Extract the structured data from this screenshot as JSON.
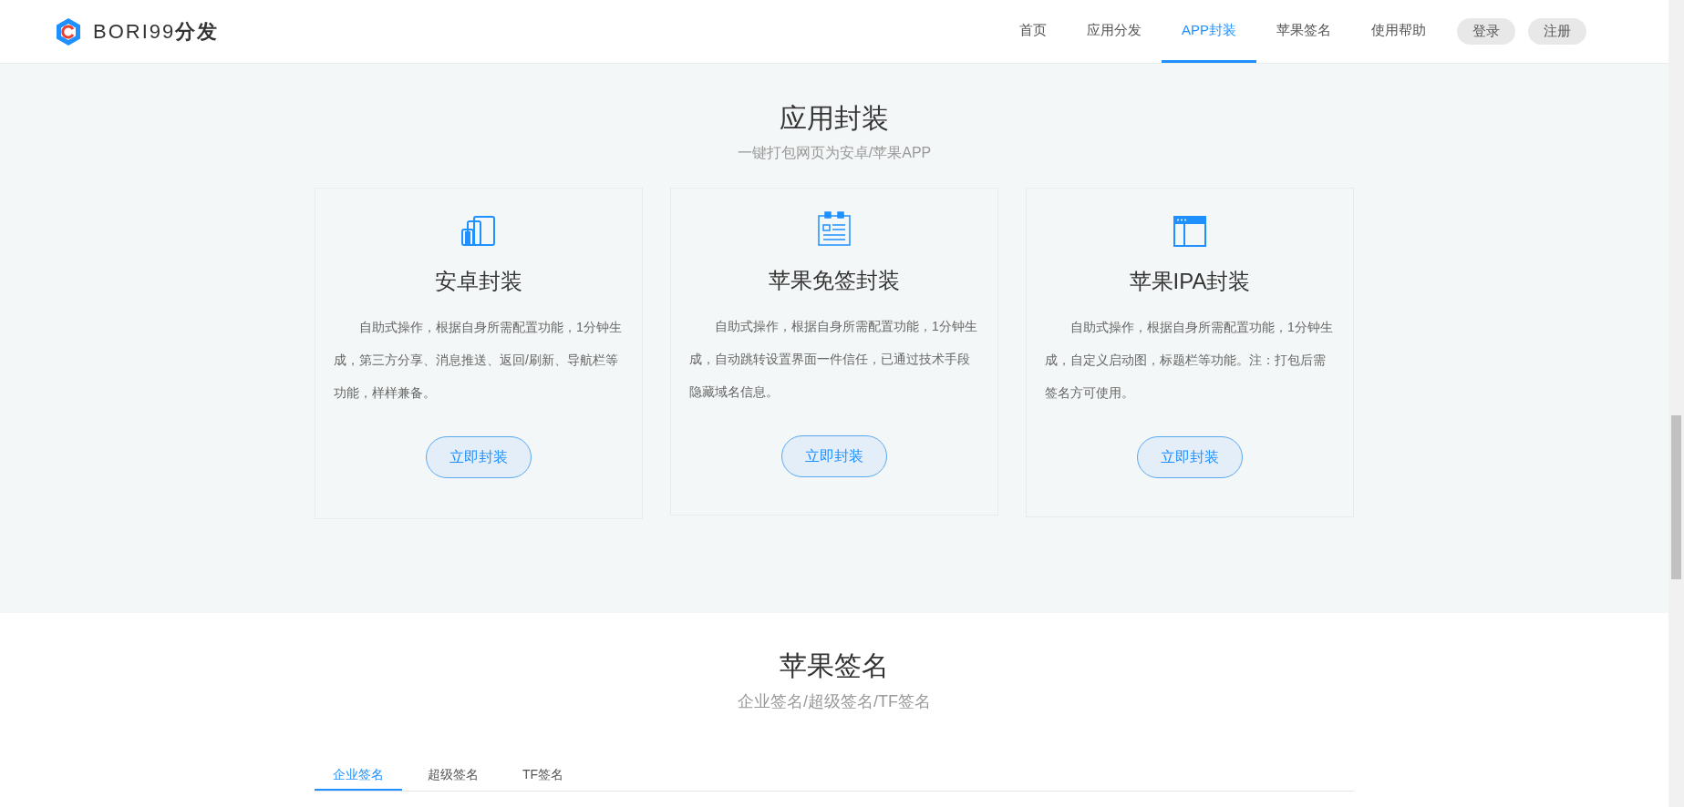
{
  "header": {
    "logo_text": "BORI99",
    "logo_bold": "分发",
    "nav": [
      {
        "label": "首页",
        "selected": false
      },
      {
        "label": "应用分发",
        "selected": false
      },
      {
        "label": "APP封装",
        "selected": true
      },
      {
        "label": "苹果签名",
        "selected": false
      },
      {
        "label": "使用帮助",
        "selected": false
      }
    ],
    "buttons": [
      "登录",
      "注册"
    ]
  },
  "packaging": {
    "title": "应用封装",
    "subtitle": "一键打包网页为安卓/苹果APP",
    "cards": [
      {
        "title": "安卓封装",
        "description": "自助式操作，根据自身所需配置功能，1分钟生成，第三方分享、消息推送、返回/刷新、导航栏等功能，样样兼备。",
        "button": "立即封装"
      },
      {
        "title": "苹果免签封装",
        "description": "自助式操作，根据自身所需配置功能，1分钟生成，自动跳转设置界面一件信任，已通过技术手段隐藏域名信息。",
        "button": "立即封装"
      },
      {
        "title": "苹果IPA封装",
        "description": "自助式操作，根据自身所需配置功能，1分钟生成，自定义启动图，标题栏等功能。注：打包后需签名方可使用。",
        "button": "立即封装"
      }
    ]
  },
  "signing": {
    "title": "苹果签名",
    "subtitle": "企业签名/超级签名/TF签名",
    "tabs": [
      {
        "label": "企业签名",
        "selected": true
      },
      {
        "label": "超级签名",
        "selected": false
      },
      {
        "label": "TF签名",
        "selected": false
      }
    ]
  }
}
